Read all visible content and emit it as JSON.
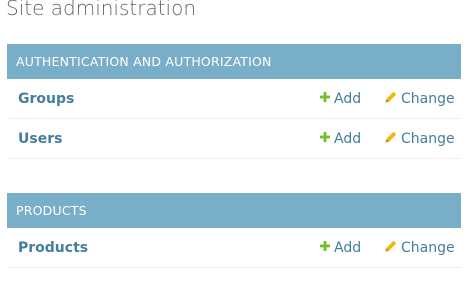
{
  "page": {
    "title": "Site administration"
  },
  "modules": [
    {
      "caption": "AUTHENTICATION AND AUTHORIZATION",
      "models": [
        {
          "name": "Groups",
          "add_label": "Add",
          "change_label": "Change"
        },
        {
          "name": "Users",
          "add_label": "Add",
          "change_label": "Change"
        }
      ]
    },
    {
      "caption": "PRODUCTS",
      "models": [
        {
          "name": "Products",
          "add_label": "Add",
          "change_label": "Change"
        }
      ]
    }
  ],
  "icons": {
    "add": "plus-icon",
    "change": "pencil-icon"
  },
  "colors": {
    "caption_bg": "#79aec8",
    "link": "#447e9b",
    "add_icon": "#70bf2b",
    "change_icon": "#efb80b"
  }
}
